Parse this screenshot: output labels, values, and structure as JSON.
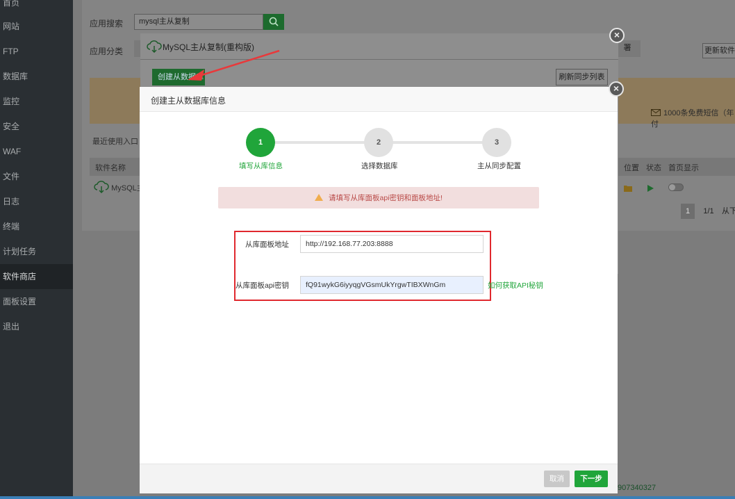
{
  "sidebar": {
    "items": [
      {
        "label": "首页"
      },
      {
        "label": "网站"
      },
      {
        "label": "FTP"
      },
      {
        "label": "数据库"
      },
      {
        "label": "监控"
      },
      {
        "label": "安全"
      },
      {
        "label": "WAF"
      },
      {
        "label": "文件"
      },
      {
        "label": "日志"
      },
      {
        "label": "终端"
      },
      {
        "label": "计划任务"
      },
      {
        "label": "软件商店"
      },
      {
        "label": "面板设置"
      },
      {
        "label": "退出"
      }
    ],
    "active_index": 11
  },
  "background": {
    "search_label": "应用搜索",
    "search_value": "mysql主从复制",
    "category_label": "应用分类",
    "update_button": "更新软件",
    "tag_fragment": "署",
    "sms_text": "1000条免费短信（年付",
    "recent_label": "最近使用入口",
    "col_name": "软件名称",
    "app_name": "MySQL主",
    "col_position": "位置",
    "col_status": "状态",
    "col_home": "首页显示",
    "page_current": "1",
    "page_total": "1/1",
    "page_next": "从下",
    "phone": "907340327"
  },
  "outer_dialog": {
    "title": "MySQL主从复制(重构版)",
    "create_button": "创建从数据库",
    "refresh_button": "刷新同步列表"
  },
  "dialog": {
    "title": "创建主从数据库信息",
    "steps": [
      {
        "number": "1",
        "label": "填写从库信息",
        "active": true
      },
      {
        "number": "2",
        "label": "选择数据库",
        "active": false
      },
      {
        "number": "3",
        "label": "主从同步配置",
        "active": false
      }
    ],
    "alert_text": "请填写从库面板api密钥和面板地址!",
    "form": {
      "panel_address_label": "从库面板地址",
      "panel_address_value": "http://192.168.77.203:8888",
      "api_key_label": "从库面板api密钥",
      "api_key_value": "fQ91wykG6iyyqgVGsmUkYrgwTIBXWnGm",
      "help_link": "如何获取API秘钥"
    },
    "cancel_button": "取消",
    "next_button": "下一步"
  },
  "colors": {
    "accent": "#20a53a",
    "alert_bg": "#f2dede",
    "alert_text": "#b94a48",
    "highlight_box": "#e0282e"
  }
}
